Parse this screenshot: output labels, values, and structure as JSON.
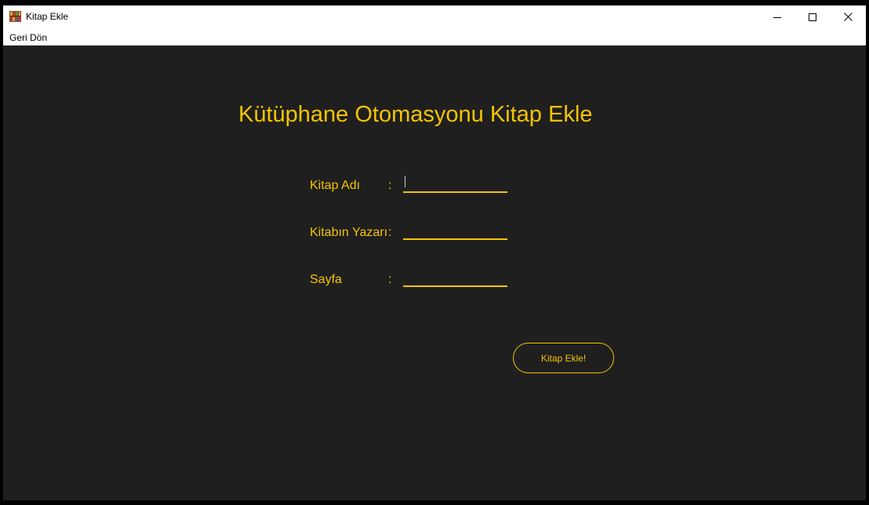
{
  "window": {
    "title": "Kitap Ekle",
    "icon": "books-icon",
    "controls": [
      "minimize-icon",
      "maximize-icon",
      "close-icon"
    ]
  },
  "menu": {
    "items": [
      {
        "label": "Geri Dön"
      }
    ]
  },
  "main": {
    "heading": "Kütüphane Otomasyonu Kitap Ekle",
    "fields": [
      {
        "label": "Kitap Adı",
        "colon": ":",
        "value": ""
      },
      {
        "label": "Kitabın Yazarı",
        "colon": ":",
        "value": ""
      },
      {
        "label": "Sayfa",
        "colon": ":",
        "value": ""
      }
    ],
    "submit_label": "Kitap Ekle!"
  },
  "colors": {
    "accent": "#f5c400",
    "background": "#1f1f1f",
    "titlebar": "#ffffff"
  }
}
